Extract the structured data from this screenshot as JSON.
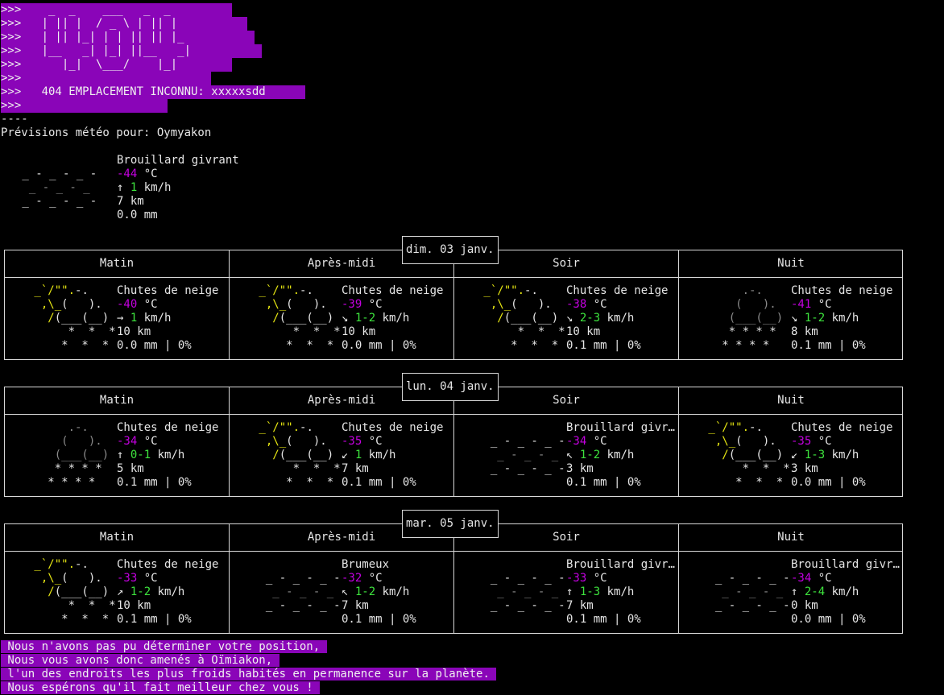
{
  "banner": {
    "lines": [
      ">>>    _  _    ___   _  _",
      ">>>   | || |  / _ \\ | || |",
      ">>>   | || |_| | | || || |_",
      ">>>   |__   _| |_| ||__   _|",
      ">>>      |_|  \\___/    |_|",
      ">>>",
      ">>>   404 EMPLACEMENT INCONNU: xxxxxsdd ",
      ">>>"
    ]
  },
  "separator": "----",
  "forecast_title": "Prévisions météo pour: Oymyakon",
  "current": {
    "art": [
      "",
      " _ - _ - _ -",
      "  _ - _ - _",
      " _ - _ - _ -",
      ""
    ],
    "desc": "Brouillard givrant",
    "temp": "-44",
    "temp_unit": " °C",
    "wind_arrow": "↑ ",
    "wind": "1",
    "wind_unit": " km/h",
    "visibility": "7 km",
    "precip": "0.0 mm"
  },
  "periods": [
    "Matin",
    "Après-midi",
    "Soir",
    "Nuit"
  ],
  "days": [
    {
      "date": "dim. 03 janv.",
      "cells": [
        {
          "art_type": "snow_sun",
          "desc": "Chutes de neige",
          "temp": "-40",
          "wind_arrow": "→ ",
          "wind": "1",
          "visibility": "10 km",
          "precip": "0.0 mm | 0%"
        },
        {
          "art_type": "snow_sun",
          "desc": "Chutes de neige",
          "temp": "-39",
          "wind_arrow": "↘ ",
          "wind": "1-2",
          "visibility": "10 km",
          "precip": "0.0 mm | 0%"
        },
        {
          "art_type": "snow_sun",
          "desc": "Chutes de neige",
          "temp": "-38",
          "wind_arrow": "↘ ",
          "wind": "2-3",
          "visibility": "10 km",
          "precip": "0.1 mm | 0%"
        },
        {
          "art_type": "heavy_snow",
          "desc": "Chutes de neige",
          "temp": "-41",
          "wind_arrow": "↘ ",
          "wind": "1-2",
          "visibility": "8 km",
          "precip": "0.1 mm | 0%"
        }
      ]
    },
    {
      "date": "lun. 04 janv.",
      "cells": [
        {
          "art_type": "heavy_snow",
          "desc": "Chutes de neige",
          "temp": "-34",
          "wind_arrow": "↑ ",
          "wind": "0-1",
          "visibility": "5 km",
          "precip": "0.1 mm | 0%"
        },
        {
          "art_type": "snow_sun",
          "desc": "Chutes de neige",
          "temp": "-35",
          "wind_arrow": "↙ ",
          "wind": "1",
          "visibility": "7 km",
          "precip": "0.1 mm | 0%"
        },
        {
          "art_type": "fog",
          "desc": "Brouillard givrant",
          "temp": "-34",
          "wind_arrow": "↖ ",
          "wind": "1-2",
          "visibility": "3 km",
          "precip": "0.1 mm | 0%"
        },
        {
          "art_type": "snow_sun",
          "desc": "Chutes de neige",
          "temp": "-35",
          "wind_arrow": "↙ ",
          "wind": "1-3",
          "visibility": "3 km",
          "precip": "0.0 mm | 0%"
        }
      ]
    },
    {
      "date": "mar. 05 janv.",
      "cells": [
        {
          "art_type": "snow_sun",
          "desc": "Chutes de neige",
          "temp": "-33",
          "wind_arrow": "↗ ",
          "wind": "1-2",
          "visibility": "10 km",
          "precip": "0.1 mm | 0%"
        },
        {
          "art_type": "fog",
          "desc": "Brumeux",
          "temp": "-32",
          "wind_arrow": "↖ ",
          "wind": "1-2",
          "visibility": "7 km",
          "precip": "0.1 mm | 0%"
        },
        {
          "art_type": "fog",
          "desc": "Brouillard givrant",
          "temp": "-33",
          "wind_arrow": "↑ ",
          "wind": "1-3",
          "visibility": "7 km",
          "precip": "0.1 mm | 0%"
        },
        {
          "art_type": "fog",
          "desc": "Brouillard givrant",
          "temp": "-34",
          "wind_arrow": "↑ ",
          "wind": "2-4",
          "visibility": "0 km",
          "precip": "0.0 mm | 0%"
        }
      ]
    }
  ],
  "units": {
    "temp": " °C",
    "wind": " km/h"
  },
  "footer": {
    "lines": [
      " Nous n'avons pas pu déterminer votre position, ",
      " Nous vous avons donc amenés à Oïmiakon, ",
      " l'un des endroits les plus froids habités en permanence sur la planète. ",
      " Nous espérons qu'il fait meilleur chez vous ! "
    ]
  },
  "colors": {
    "highlight": "#8a05b8",
    "temperature": "#c400e0",
    "wind_speed": "#3de33d",
    "sun": "#e5e512",
    "cloud_dim": "#8a8a8a"
  }
}
